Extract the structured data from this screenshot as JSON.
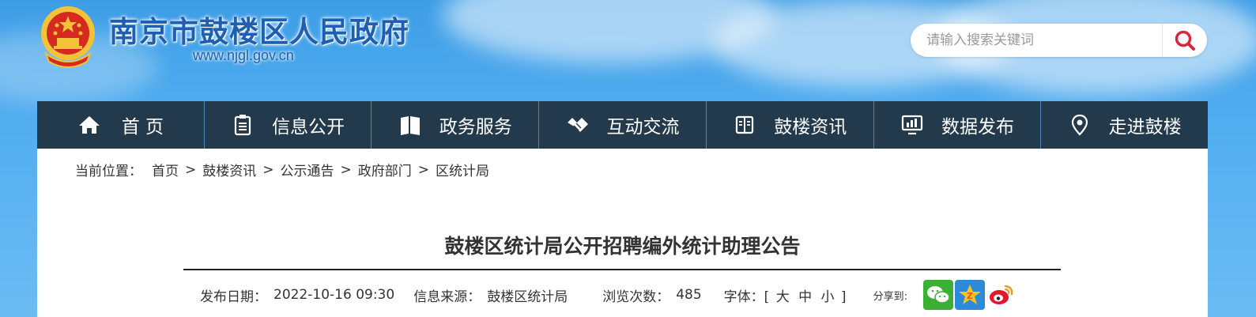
{
  "header": {
    "site_title": "南京市鼓楼区人民政府",
    "site_url": "www.njgl.gov.cn",
    "emblem_icon": "national-emblem-icon"
  },
  "search": {
    "placeholder": "请输入搜索关键词",
    "button_icon": "search-icon"
  },
  "nav": {
    "items": [
      {
        "label": "首 页",
        "icon": "home-icon"
      },
      {
        "label": "信息公开",
        "icon": "clipboard-icon"
      },
      {
        "label": "政务服务",
        "icon": "book-open-icon"
      },
      {
        "label": "互动交流",
        "icon": "handshake-icon"
      },
      {
        "label": "鼓楼资讯",
        "icon": "book-icon"
      },
      {
        "label": "数据发布",
        "icon": "monitor-chart-icon"
      },
      {
        "label": "走进鼓楼",
        "icon": "location-pin-icon"
      }
    ]
  },
  "breadcrumb": {
    "lead": "当前位置：",
    "items": [
      "首页",
      "鼓楼资讯",
      "公示通告",
      "政府部门",
      "区统计局"
    ],
    "separator": ">"
  },
  "article": {
    "title": "鼓楼区统计局公开招聘编外统计助理公告",
    "publish_label": "发布日期：",
    "publish_date": "2022-10-16 09:30",
    "source_label": "信息来源：",
    "source": "鼓楼区统计局",
    "views_label": "浏览次数：",
    "views": "485",
    "font_label": "字体：",
    "font_open": "[",
    "font_large": "大",
    "font_medium": "中",
    "font_small": "小",
    "font_close": "]",
    "share_label": "分享到:"
  },
  "share": {
    "items": [
      "wechat-icon",
      "qzone-icon",
      "weibo-icon"
    ]
  },
  "colors": {
    "nav_bg": "#233a4c",
    "title_blue": "#1f5fb0",
    "search_icon_red": "#d7263d"
  }
}
